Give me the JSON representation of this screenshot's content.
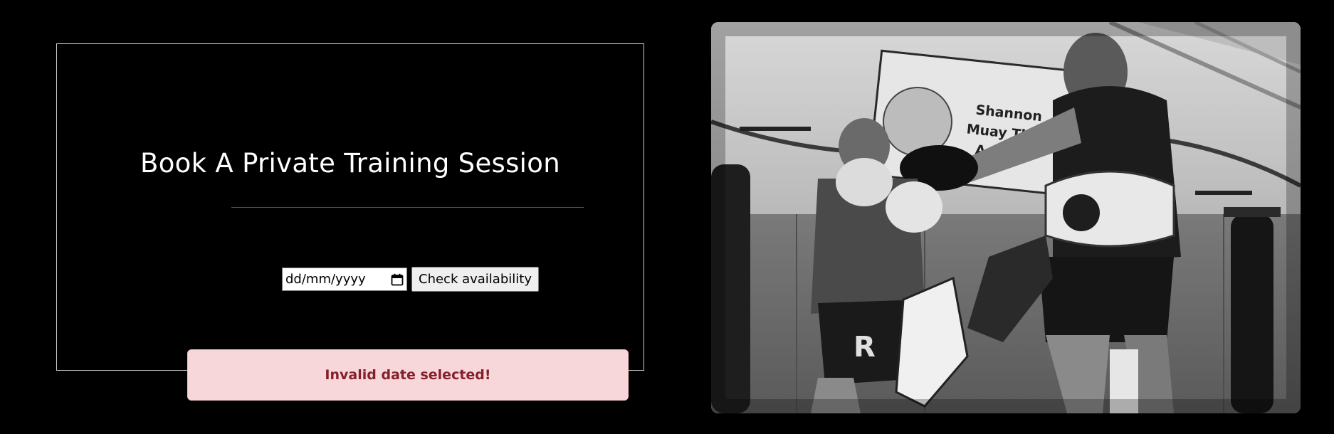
{
  "booking": {
    "title": "Book A Private Training Session",
    "date_input": {
      "placeholder": "dd/mm/yyyy"
    },
    "check_button_label": "Check availability",
    "alert_message": "Invalid date selected!"
  },
  "photo": {
    "alt": "Muay Thai coach holding kick pads for a fighter in a gym",
    "banner_text": [
      "Shannon",
      "Muay Th",
      "Aca"
    ],
    "shorts_text": "R",
    "style": "black-and-white"
  },
  "colors": {
    "page_background": "#000000",
    "alert_background": "#f8d7da",
    "alert_text": "#842029",
    "card_border": "#cfcfcf"
  }
}
